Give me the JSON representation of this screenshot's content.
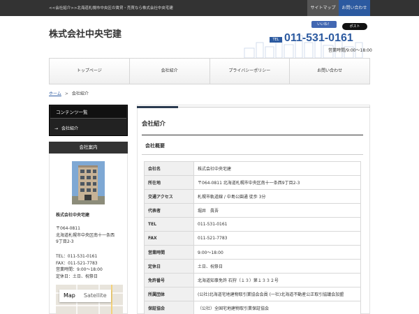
{
  "topbar": {
    "tagline": "<<会社紹介>>北海道札幌市中央区の賃貸・売買なら株式会社中央宅建",
    "sitemap": "サイトマップ",
    "contact": "お問い合わせ"
  },
  "header": {
    "site_title": "株式会社中央宅建",
    "like_label": "いいね！",
    "post_label": "ポスト",
    "tel_badge": "TEL",
    "tel_number": "011-531-0161",
    "hours": "営業時間/9:00～18:00"
  },
  "nav": [
    "トップページ",
    "会社紹介",
    "プライバシーポリシー",
    "お問い合わせ"
  ],
  "breadcrumb": {
    "home": "ホーム",
    "sep": ">",
    "current": "会社紹介"
  },
  "sidebar": {
    "contents_heading": "コンテンツ一覧",
    "contents_arrow": "→",
    "contents_link": "会社紹介",
    "company_heading": "会社案内",
    "company_name": "株式会社中央宅建",
    "postal": "〒064-0811",
    "address1": "北海道札幌市中央区南十一条西",
    "address2": "9丁目2-3",
    "tel": "TEL：011-531-0161",
    "fax": "FAX：011-521-7783",
    "hours": "営業時間：9:00～18:00",
    "holiday": "定休日：土日、祝祭日",
    "map_tab_map": "Map",
    "map_tab_satellite": "Satellite"
  },
  "main": {
    "page_title": "会社紹介",
    "section_title": "会社概要",
    "rows": [
      {
        "label": "会社名",
        "value": "株式会社中央宅建"
      },
      {
        "label": "所在地",
        "value": "〒064-0811 北海道札幌市中央区南十一条西9丁目2-3"
      },
      {
        "label": "交通アクセス",
        "value": "札幌市軌道線 / 中島公園通 徒歩 3分"
      },
      {
        "label": "代表者",
        "value": "堀井　眞吾"
      },
      {
        "label": "TEL",
        "value": "011-531-0161"
      },
      {
        "label": "FAX",
        "value": "011-521-7783"
      },
      {
        "label": "営業時間",
        "value": "9:00～18:00"
      },
      {
        "label": "定休日",
        "value": "土日、祝祭日"
      },
      {
        "label": "免許番号",
        "value": "北海道知事免許 石狩（１３）第１３３２号"
      },
      {
        "label": "所属団体",
        "value": "(公社)北海道宅地建物取引業協会会員 (一社)北海道不動産公正取引協議会加盟"
      },
      {
        "label": "保証協会",
        "value": "（公社）全国宅地建物取引業保証協会"
      },
      {
        "label": "",
        "value": ""
      }
    ]
  },
  "colors": {
    "accent": "#2c5aa0",
    "topbar": "#333333",
    "sidebar_dark": "#222222"
  }
}
